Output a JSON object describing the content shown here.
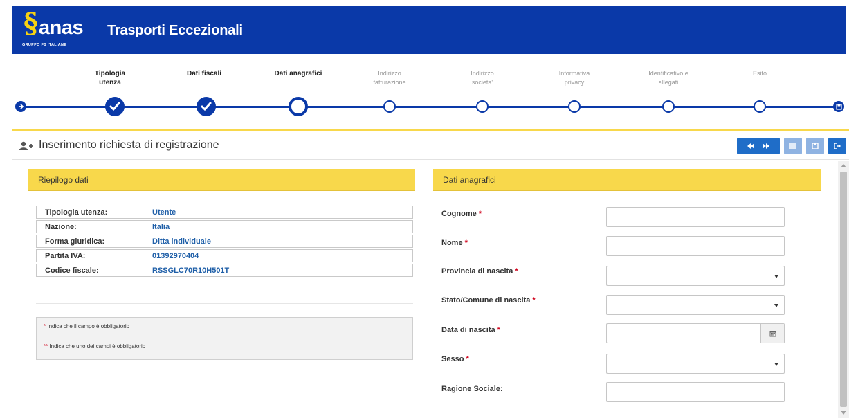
{
  "header": {
    "logo_word": "anas",
    "logo_subtitle": "GRUPPO FS ITALIANE",
    "app_title": "Trasporti Eccezionali"
  },
  "stepper": {
    "steps": [
      {
        "label_line1": "Tipologia",
        "label_line2": "utenza",
        "state": "done"
      },
      {
        "label_line1": "Dati fiscali",
        "label_line2": "",
        "state": "done"
      },
      {
        "label_line1": "Dati anagrafici",
        "label_line2": "",
        "state": "active"
      },
      {
        "label_line1": "Indirizzo",
        "label_line2": "fatturazione",
        "state": "pending"
      },
      {
        "label_line1": "Indirizzo",
        "label_line2": "societa'",
        "state": "pending"
      },
      {
        "label_line1": "Informativa",
        "label_line2": "privacy",
        "state": "pending"
      },
      {
        "label_line1": "Identificativo e",
        "label_line2": "allegati",
        "state": "pending"
      },
      {
        "label_line1": "Esito",
        "label_line2": "",
        "state": "pending"
      }
    ],
    "start_icon": "arrow-right-circle-icon",
    "end_icon": "save-icon"
  },
  "panel": {
    "title": "Inserimento richiesta di registrazione",
    "title_icon": "add-user-icon",
    "toolbar_icons": [
      "step-backward-icon",
      "step-forward-icon",
      "list-icon",
      "save-icon",
      "exit-icon"
    ]
  },
  "summary": {
    "title": "Riepilogo dati",
    "rows": [
      {
        "key": "Tipologia utenza:",
        "value": "Utente"
      },
      {
        "key": "Nazione:",
        "value": "Italia"
      },
      {
        "key": "Forma giuridica:",
        "value": "Ditta individuale"
      },
      {
        "key": "Partita IVA:",
        "value": "01392970404"
      },
      {
        "key": "Codice fiscale:",
        "value": "RSSGLC70R10H501T"
      }
    ],
    "note1_star": "*",
    "note1_text": " Indica che il campo è obbligatorio",
    "note2_star": "**",
    "note2_text": " Indica che uno dei campi è obbligatorio"
  },
  "form": {
    "title": "Dati anagrafici",
    "required_mark": "*",
    "fields": [
      {
        "label": "Cognome",
        "required": true,
        "type": "text",
        "value": ""
      },
      {
        "label": "Nome",
        "required": true,
        "type": "text",
        "value": ""
      },
      {
        "label": "Provincia di nascita",
        "required": true,
        "type": "select",
        "value": ""
      },
      {
        "label": "Stato/Comune di nascita",
        "required": true,
        "type": "select",
        "value": ""
      },
      {
        "label": "Data di nascita",
        "required": true,
        "type": "date",
        "value": ""
      },
      {
        "label": "Sesso",
        "required": true,
        "type": "select",
        "value": ""
      },
      {
        "label": "Ragione Sociale:",
        "required": false,
        "type": "text",
        "value": ""
      }
    ]
  },
  "colors": {
    "brand_blue": "#0a39a8",
    "accent_yellow": "#f8d84b",
    "button_blue": "#1f6dc8",
    "button_disabled": "#8fb3e2",
    "required_red": "#d0021b",
    "value_blue": "#1f5fa8"
  }
}
